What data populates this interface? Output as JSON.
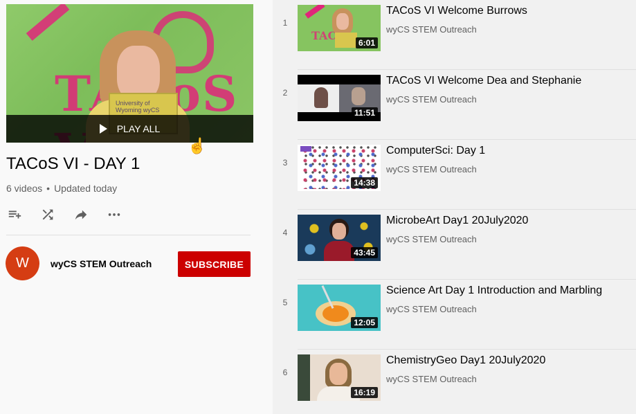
{
  "playlist": {
    "title": "TACoS VI - DAY 1",
    "video_count": "6 videos",
    "separator": "•",
    "updated": "Updated today",
    "play_all_label": "PLAY ALL",
    "hero_shirt_text": "TACoS V",
    "hero_sign_text": "University of Wyoming wyCS"
  },
  "actions": {
    "icons": [
      "add-to-queue-icon",
      "shuffle-icon",
      "share-icon",
      "more-icon"
    ]
  },
  "owner": {
    "avatar_letter": "W",
    "name": "wyCS STEM Outreach",
    "subscribe_label": "SUBSCRIBE",
    "avatar_color": "#d53d13",
    "subscribe_color": "#cc0000"
  },
  "videos": [
    {
      "index": "1",
      "title": "TACoS VI Welcome Burrows",
      "channel": "wyCS STEM Outreach",
      "duration": "6:01"
    },
    {
      "index": "2",
      "title": "TACoS VI Welcome Dea and Stephanie",
      "channel": "wyCS STEM Outreach",
      "duration": "11:51"
    },
    {
      "index": "3",
      "title": "ComputerSci: Day 1",
      "channel": "wyCS STEM Outreach",
      "duration": "14:38"
    },
    {
      "index": "4",
      "title": "MicrobeArt Day1 20July2020",
      "channel": "wyCS STEM Outreach",
      "duration": "43:45"
    },
    {
      "index": "5",
      "title": "Science Art Day 1 Introduction and Marbling",
      "channel": "wyCS STEM Outreach",
      "duration": "12:05"
    },
    {
      "index": "6",
      "title": "ChemistryGeo Day1 20July2020",
      "channel": "wyCS STEM Outreach",
      "duration": "16:19"
    }
  ]
}
